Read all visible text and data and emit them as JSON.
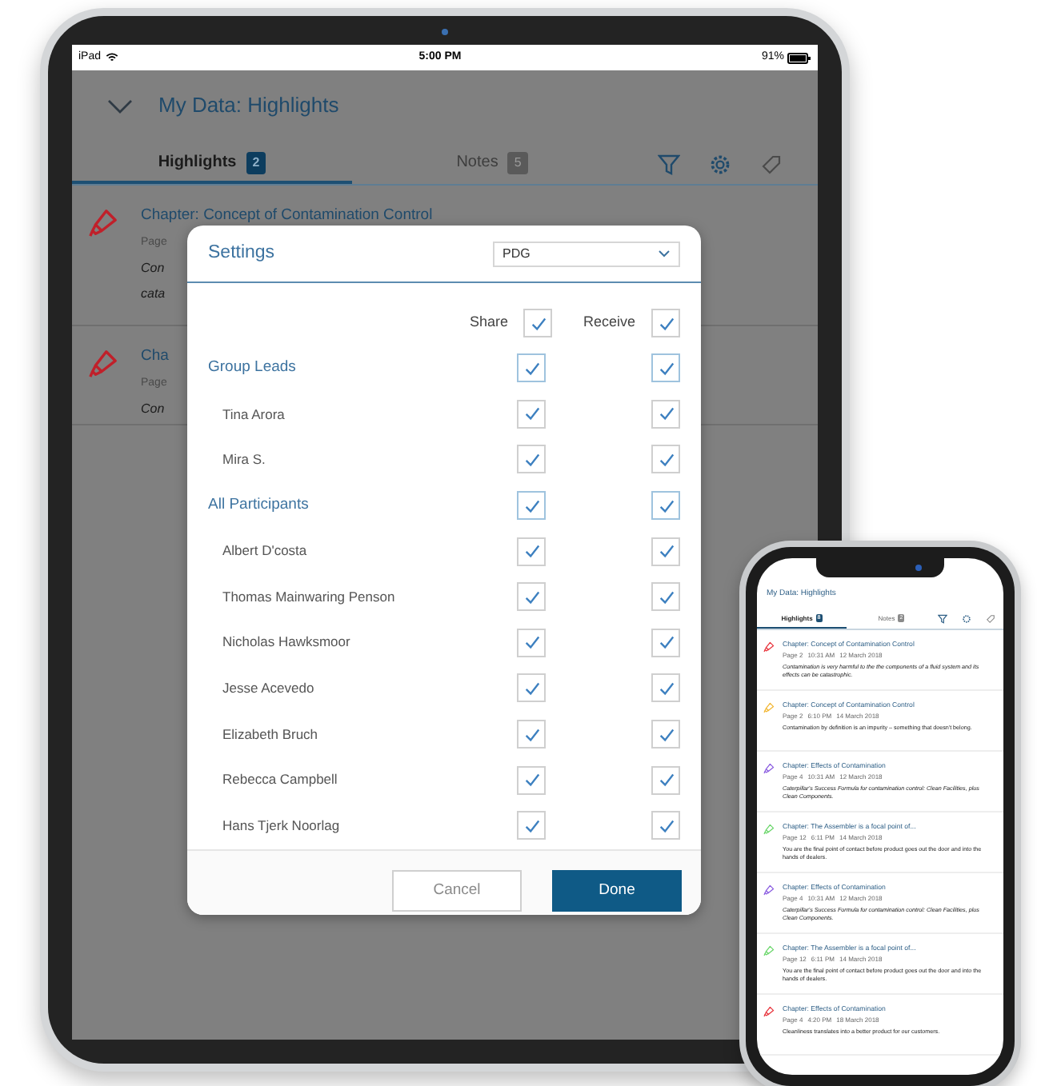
{
  "tablet": {
    "status_bar": {
      "device": "iPad",
      "time": "5:00 PM",
      "battery": "91%"
    },
    "header": {
      "title": "My Data: Highlights"
    },
    "tabs": [
      {
        "label": "Highlights",
        "count": "2",
        "selected": true
      },
      {
        "label": "Notes",
        "count": "5",
        "selected": false
      }
    ],
    "background_items": [
      {
        "color": "#c0202a",
        "title": "Chapter: Concept of Contamination Control",
        "meta": "Page",
        "excerpt": [
          "Con",
          "cata"
        ]
      },
      {
        "color": "#c0202a",
        "title": "Cha",
        "meta": "Page",
        "excerpt": [
          "Con"
        ]
      }
    ],
    "settings_dialog": {
      "title": "Settings",
      "group_select": "PDG",
      "columns": [
        {
          "label": "Share",
          "checked": true
        },
        {
          "label": "Receive",
          "checked": true
        }
      ],
      "rows": [
        {
          "kind": "group",
          "label": "Group Leads",
          "share": true,
          "receive": true
        },
        {
          "kind": "person",
          "label": "Tina Arora",
          "share": true,
          "receive": true
        },
        {
          "kind": "person",
          "label": "Mira S.",
          "share": true,
          "receive": true
        },
        {
          "kind": "group",
          "label": "All Participants",
          "share": true,
          "receive": true
        },
        {
          "kind": "person",
          "label": "Albert D'costa",
          "share": true,
          "receive": true
        },
        {
          "kind": "person",
          "label": "Thomas Mainwaring Penson",
          "share": true,
          "receive": true
        },
        {
          "kind": "person",
          "label": "Nicholas Hawksmoor",
          "share": true,
          "receive": true
        },
        {
          "kind": "person",
          "label": "Jesse Acevedo",
          "share": true,
          "receive": true
        },
        {
          "kind": "person",
          "label": "Elizabeth Bruch",
          "share": true,
          "receive": true
        },
        {
          "kind": "person",
          "label": "Rebecca Campbell",
          "share": true,
          "receive": true
        },
        {
          "kind": "person",
          "label": "Hans Tjerk Noorlag",
          "share": true,
          "receive": true
        }
      ],
      "buttons": [
        {
          "label": "Cancel",
          "kind": "secondary"
        },
        {
          "label": "Done",
          "kind": "primary"
        }
      ]
    }
  },
  "phone": {
    "header": {
      "title": "My Data: Highlights"
    },
    "tabs": [
      {
        "label": "Highlights",
        "count": "8",
        "selected": true
      },
      {
        "label": "Notes",
        "count": "2",
        "selected": false
      }
    ],
    "items": [
      {
        "color": "#e8343c",
        "title": "Chapter: Concept of Contamination Control",
        "page": "Page 2",
        "time": "10:31 AM",
        "date": "12 March 2018",
        "excerpt": "Contamination is very harmful to the the components of a fluid system and its effects can be catastrophic.",
        "italic": true
      },
      {
        "color": "#f2b632",
        "title": "Chapter: Concept of Contamination Control",
        "page": "Page 2",
        "time": "6:10 PM",
        "date": "14 March 2018",
        "excerpt": "Contamination by definition is an impurity – something that doesn't belong.",
        "italic": false
      },
      {
        "color": "#8a5ce0",
        "title": "Chapter: Effects of Contamination",
        "page": "Page 4",
        "time": "10:31 AM",
        "date": "12 March 2018",
        "excerpt": "Caterpillar's Success Formula for contamination control: Clean Facilities, plus Clean Components.",
        "italic": true
      },
      {
        "color": "#6ad66a",
        "title": "Chapter: The Assembler is a focal point of...",
        "page": "Page 12",
        "time": "6:11 PM",
        "date": "14 March 2018",
        "excerpt": "You are the final point of contact before product goes out the door and into the hands of dealers.",
        "italic": false
      },
      {
        "color": "#8a5ce0",
        "title": "Chapter: Effects of Contamination",
        "page": "Page 4",
        "time": "10:31 AM",
        "date": "12 March 2018",
        "excerpt": "Caterpillar's Success Formula for contamination control: Clean Facilities, plus Clean Components.",
        "italic": true
      },
      {
        "color": "#6ad66a",
        "title": "Chapter: The Assembler is a focal point of...",
        "page": "Page 12",
        "time": "6:11 PM",
        "date": "14 March 2018",
        "excerpt": "You are the final point of contact before product goes out the door and into the hands of dealers.",
        "italic": false
      },
      {
        "color": "#e8343c",
        "title": "Chapter: Effects of Contamination",
        "page": "Page 4",
        "time": "4:20 PM",
        "date": "18 March 2018",
        "excerpt": "Cleanliness translates into a better product for our customers.",
        "italic": false
      }
    ]
  }
}
